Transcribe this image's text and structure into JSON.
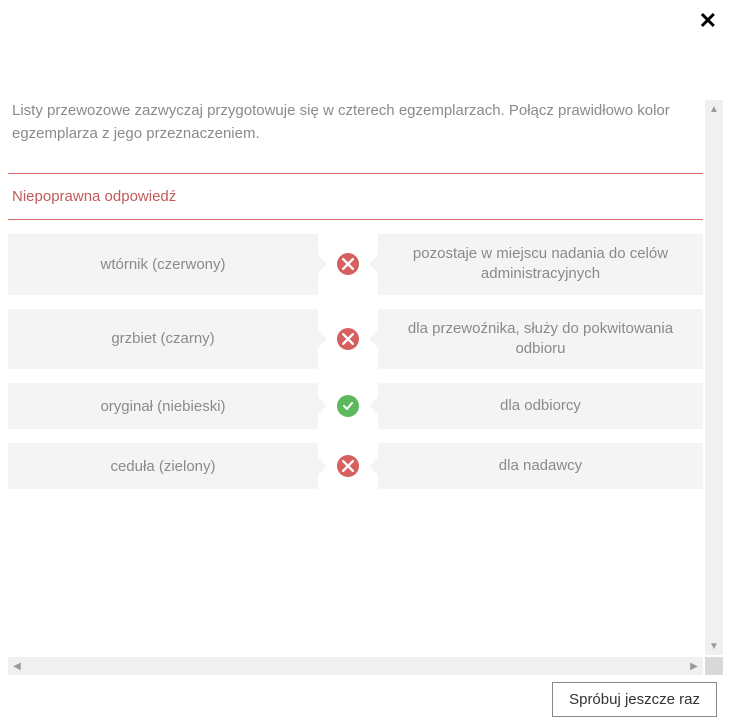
{
  "close_label": "✕",
  "question_text": "Listy przewozowe zazwyczaj przygotowuje się w czterech egzemplarzach. Połącz prawidłowo kolor egzemplarza z jego przeznaczeniem.",
  "feedback_text": "Niepoprawna odpowiedź",
  "rows": [
    {
      "left": "wtórnik (czerwony)",
      "status": "wrong",
      "right": "pozostaje w miejscu nadania do celów administracyjnych"
    },
    {
      "left": "grzbiet (czarny)",
      "status": "wrong",
      "right": "dla przewoźnika, służy do pokwitowania odbioru"
    },
    {
      "left": "oryginał (niebieski)",
      "status": "correct",
      "right": "dla odbiorcy"
    },
    {
      "left": "ceduła (zielony)",
      "status": "wrong",
      "right": "dla nadawcy"
    }
  ],
  "retry_label": "Spróbuj jeszcze raz"
}
